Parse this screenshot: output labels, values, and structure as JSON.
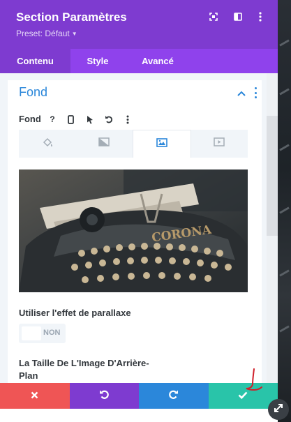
{
  "header": {
    "title": "Section Paramètres",
    "preset": "Preset: Défaut",
    "icons": [
      "expand-icon",
      "split-view-icon",
      "more-vert-icon"
    ]
  },
  "tabs": [
    {
      "label": "Contenu",
      "active": true
    },
    {
      "label": "Style",
      "active": false
    },
    {
      "label": "Avancé",
      "active": false
    }
  ],
  "section": {
    "title": "Fond",
    "field_label": "Fond",
    "field_icons": [
      "help-icon",
      "mobile-icon",
      "cursor-icon",
      "undo-icon",
      "more-vert-icon"
    ],
    "background_tabs": [
      {
        "icon": "paint-bucket-icon",
        "active": false
      },
      {
        "icon": "gradient-icon",
        "active": false
      },
      {
        "icon": "image-icon",
        "active": true
      },
      {
        "icon": "video-icon",
        "active": false
      }
    ],
    "photo_text": "CORONA",
    "parallax_label": "Utiliser l'effet de parallaxe",
    "parallax_value": "NON",
    "size_label": "La Taille De L'Image D'Arrière-Plan"
  },
  "footer": {
    "buttons": [
      {
        "icon": "close-icon",
        "color": "#ef5555"
      },
      {
        "icon": "undo-icon",
        "color": "#7e3bd0"
      },
      {
        "icon": "redo-icon",
        "color": "#2b87da"
      },
      {
        "icon": "check-icon",
        "color": "#29c4a9"
      }
    ]
  },
  "colors": {
    "header": "#7e3bd0",
    "tabs": "#8f42ec",
    "accent_blue": "#2b87da"
  }
}
